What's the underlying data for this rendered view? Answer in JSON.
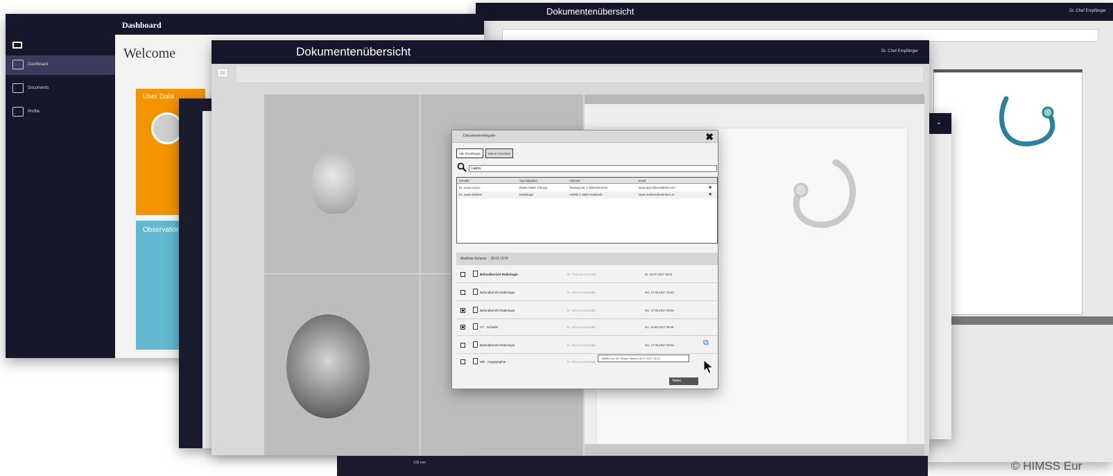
{
  "dashboard": {
    "title": "Dashboard",
    "welcome": "Welcome",
    "nav": [
      {
        "label": "Dashboard"
      },
      {
        "label": "Documents"
      },
      {
        "label": "Profile"
      }
    ],
    "user_card_title": "User Data",
    "observations_title": "Observations"
  },
  "back_window": {
    "title": "Dokumentenübersicht",
    "user": "Dr. Chef Empfänger"
  },
  "main_window": {
    "title": "Dokumentenübersicht",
    "user": "Dr. Chef Empfänger"
  },
  "dialog": {
    "title": "Dokumentenfreigabe",
    "tabs": [
      "Alle Empfänger",
      "Meine Favoriten"
    ],
    "search_value": "Laura",
    "columns": [
      "Kontakt",
      "Spezialgebiet",
      "Adresse",
      "email"
    ],
    "contacts": [
      {
        "name": "Dr. Laura Leyco",
        "spec": "Radio-Abteil. Chirurg",
        "addr": "Testweg Str. 1 3600 Dornbirn",
        "email": "laura.leyco@veindirekt.com"
      },
      {
        "name": "Dr. Laura Mettner",
        "spec": "Radiologie",
        "addr": "Anfeld 3, 6600 Innsbruck",
        "email": "laura.mettner@vmintern.at"
      }
    ],
    "patient": "Matthias Scherer",
    "patient_dob": "28.01.1978",
    "documents": [
      {
        "name": "Befundbericht Radiologie",
        "author": "Dr. Thomas Lorenzen",
        "date": "Di. 18.07.2017 15:41",
        "checked": false
      },
      {
        "name": "Befundbericht Radiologie",
        "author": "Dr. Mirco Kruschinski",
        "date": "Mo. 17.06.2017 15:43",
        "checked": false
      },
      {
        "name": "Befundbericht Radiologie",
        "author": "Dr. Mirco Kruschinski",
        "date": "Mo. 17.06.2017 09:46",
        "checked": true
      },
      {
        "name": "CT - Schädel",
        "author": "Dr. Mirco Kruschinski",
        "date": "Do. 13.06.2017 09:46",
        "checked": true
      },
      {
        "name": "Befundbericht Radiologie",
        "author": "Dr. Mirco Kruschinski",
        "date": "Mo. 17.06.2017 09:46",
        "checked": false
      },
      {
        "name": "MR - Angiographie",
        "author": "Dr. Mirco Kruschinski",
        "date": "",
        "checked": false
      }
    ],
    "tooltip": "Geteilt von: Dr. Ehsan Stumm 18.07.2017 10:21",
    "ok_label": "Teilen"
  },
  "bottom": {
    "ruler_label": "100 mm"
  },
  "copyright": "© HIMSS Eur"
}
